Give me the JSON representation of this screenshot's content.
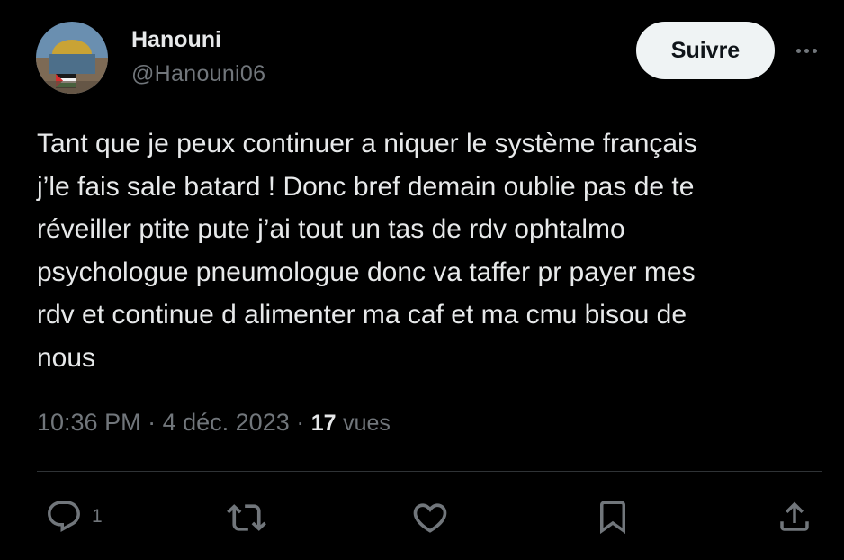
{
  "user": {
    "name": "Hanouni",
    "handle": "@Hanouni06"
  },
  "follow_button": {
    "label": "Suivre"
  },
  "tweet": {
    "text": "Tant que je peux continuer a niquer le système français\nj’le fais sale batard ! Donc bref demain oublie pas de te\nréveiller ptite pute j’ai tout un tas de rdv ophtalmo\npsychologue pneumologue donc va taffer pr payer mes\nrdv et continue d alimenter ma caf et ma cmu bisou de\nnous",
    "time": "10:36 PM",
    "separator": "·",
    "date": "4 déc. 2023",
    "views_count": "17",
    "views_label": "vues"
  },
  "actions": {
    "reply_count": "1"
  },
  "icons": {
    "more": "more-horizontal-icon",
    "reply": "reply-icon",
    "retweet": "retweet-icon",
    "like": "heart-icon",
    "bookmark": "bookmark-icon",
    "share": "share-icon"
  },
  "colors": {
    "background": "#000000",
    "primary_text": "#e7e9ea",
    "secondary_text": "#71767b",
    "button_bg": "#eff3f4",
    "button_text": "#0f1419",
    "divider": "#2f3336"
  }
}
